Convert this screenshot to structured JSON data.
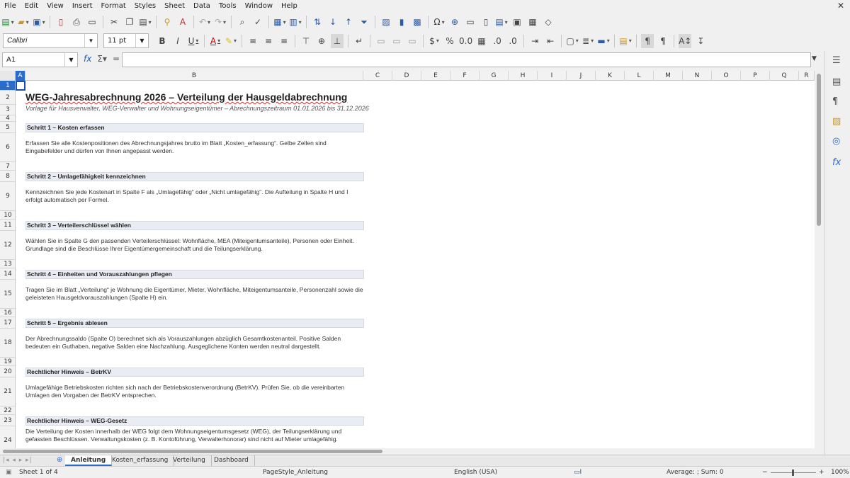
{
  "menu": [
    "File",
    "Edit",
    "View",
    "Insert",
    "Format",
    "Styles",
    "Sheet",
    "Data",
    "Tools",
    "Window",
    "Help"
  ],
  "toolbar_font": {
    "name": "Calibri",
    "size": "11 pt"
  },
  "formula_bar": {
    "cell_ref": "A1",
    "content": ""
  },
  "columns": [
    "A",
    "B",
    "C",
    "D",
    "E",
    "F",
    "G",
    "H",
    "I",
    "J",
    "K",
    "L",
    "M",
    "N",
    "O",
    "P",
    "Q",
    "R"
  ],
  "rows": [
    "1",
    "2",
    "3",
    "4",
    "5",
    "6",
    "7",
    "8",
    "9",
    "10",
    "11",
    "12",
    "13",
    "14",
    "15",
    "16",
    "17",
    "18",
    "19",
    "20",
    "21",
    "22",
    "23",
    "24"
  ],
  "sheet": {
    "title": "WEG-Jahresabrechnung 2026 – Verteilung der Hausgeldabrechnung",
    "subtitle": "Vorlage für Hausverwalter, WEG-Verwalter und Wohnungseigentümer – Abrechnungszeitraum 01.01.2026 bis 31.12.2026",
    "sections": [
      {
        "heading": "Schritt 1 – Kosten erfassen",
        "body": "Erfassen Sie alle Kostenpositionen des Abrechnungsjahres brutto im Blatt „Kosten_erfassung“. Gelbe Zellen sind Eingabefelder und dürfen von Ihnen angepasst werden."
      },
      {
        "heading": "Schritt 2 – Umlagefähigkeit kennzeichnen",
        "body": "Kennzeichnen Sie jede Kostenart in Spalte F als „Umlagefähig“ oder „Nicht umlagefähig“. Die Aufteilung in Spalte H und I erfolgt automatisch per Formel."
      },
      {
        "heading": "Schritt 3 – Verteilerschlüssel wählen",
        "body": "Wählen Sie in Spalte G den passenden Verteilerschlüssel: Wohnfläche, MEA (Miteigentumsanteile), Personen oder Einheit. Grundlage sind die Beschlüsse Ihrer Eigentümergemeinschaft und die Teilungserklärung."
      },
      {
        "heading": "Schritt 4 – Einheiten und Vorauszahlungen pflegen",
        "body": "Tragen Sie im Blatt „Verteilung“ je Wohnung die Eigentümer, Mieter, Wohnfläche, Miteigentumsanteile, Personenzahl sowie die geleisteten Hausgeldvorauszahlungen (Spalte H) ein."
      },
      {
        "heading": "Schritt 5 – Ergebnis ablesen",
        "body": "Der Abrechnungssaldo (Spalte O) berechnet sich als Vorauszahlungen abzüglich Gesamtkostenanteil. Positive Salden bedeuten ein Guthaben, negative Salden eine Nachzahlung. Ausgeglichene Konten werden neutral dargestellt."
      },
      {
        "heading": "Rechtlicher Hinweis – BetrKV",
        "body": "Umlagefähige Betriebskosten richten sich nach der Betriebskostenverordnung (BetrKV). Prüfen Sie, ob die vereinbarten Umlagen den Vorgaben der BetrKV entsprechen."
      },
      {
        "heading": "Rechtlicher Hinweis – WEG-Gesetz",
        "body": "Die Verteilung der Kosten innerhalb der WEG folgt dem Wohnungseigentumsgesetz (WEG), der Teilungserklärung und gefassten Beschlüssen. Verwaltungskosten (z. B. Kontoführung, Verwalterhonorar) sind nicht auf Mieter umlagefähig."
      }
    ]
  },
  "tabs": [
    "Anleitung",
    "Kosten_erfassung",
    "Verteilung",
    "Dashboard"
  ],
  "status": {
    "sheet_pos": "Sheet 1 of 4",
    "page_style": "PageStyle_Anleitung",
    "language": "English (USA)",
    "summary": "Average: ; Sum: 0",
    "zoom": "100%"
  }
}
